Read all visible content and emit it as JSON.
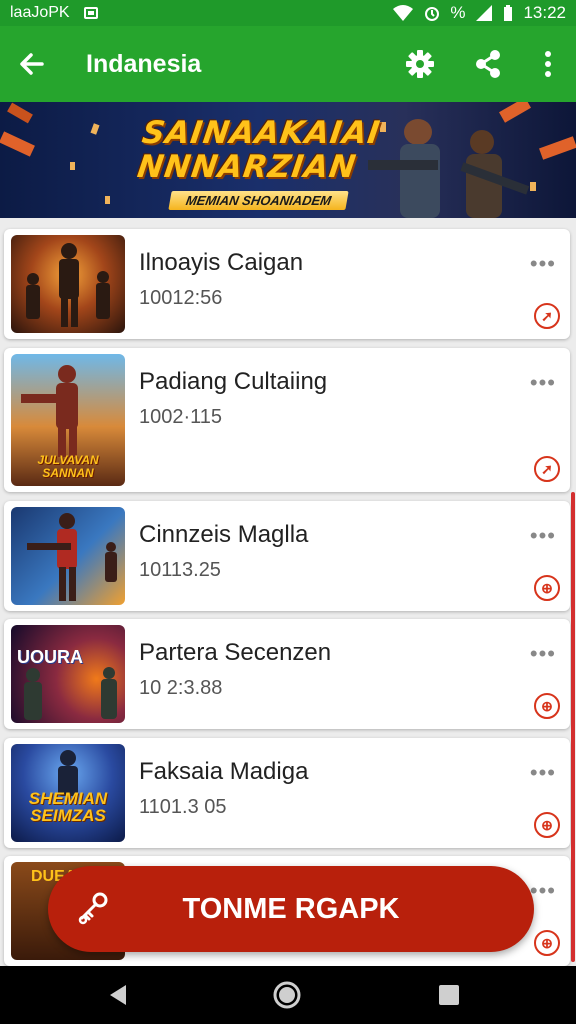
{
  "status_bar": {
    "left_text": "laaJoPK",
    "percent_text": "%",
    "time": "13:22"
  },
  "app_bar": {
    "title": "Indanesia"
  },
  "banner": {
    "title_line1": "SAINAAKAIAI",
    "title_line2": "NNNARZIAN",
    "subtitle": "MEMIAN SHOANIADEM"
  },
  "items": [
    {
      "name": "Ilnoayis Caigan",
      "code": "10012:56",
      "thumb_text": "",
      "badge": "➚"
    },
    {
      "name": "Padiang Cultaiing",
      "code": "1002·115",
      "thumb_text": "JULVAVAN SANNAN",
      "badge": "➚"
    },
    {
      "name": "Cinnzeis Maglla",
      "code": "10113.25",
      "thumb_text": "",
      "badge": "⊕"
    },
    {
      "name": "Partera Secenzen",
      "code": "10 2:3.88",
      "thumb_text": "UOURA",
      "badge": "⊕"
    },
    {
      "name": "Faksaia Madiga",
      "code": "1101.3 05",
      "thumb_text": "SHEMIAN SEIMZAS",
      "badge": "⊕"
    },
    {
      "name": "",
      "code": "",
      "thumb_text": "DUEA",
      "badge": "⊕"
    }
  ],
  "fab": {
    "label": "TONME RGAPK"
  },
  "colors": {
    "app_green": "#26a52d",
    "status_green": "#1f9a2a",
    "accent_red": "#b8200c"
  }
}
